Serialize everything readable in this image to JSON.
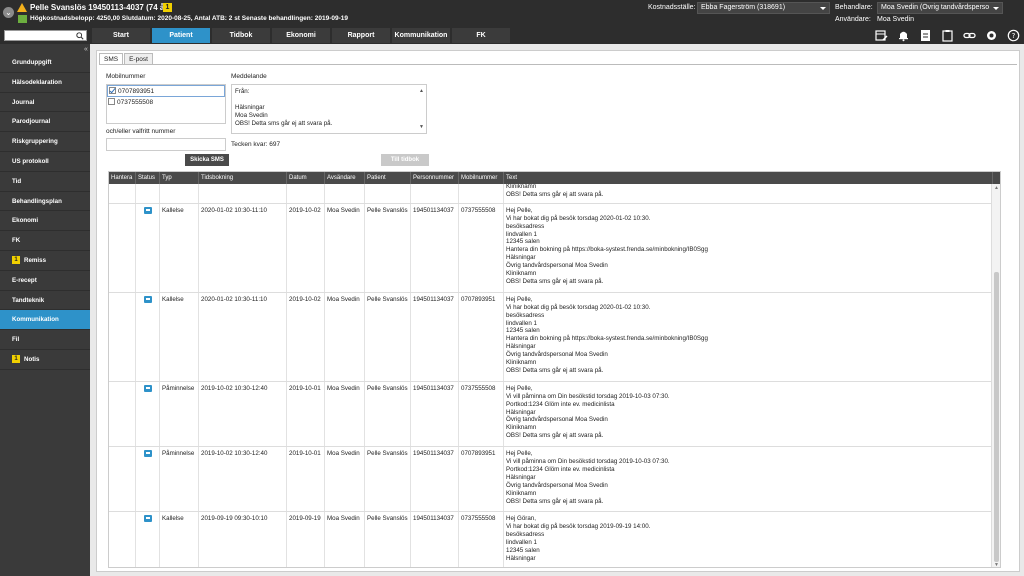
{
  "header": {
    "patient_name": "Pelle Svanslös 19450113-4037 (74 år)",
    "patient_badge": "1",
    "patient_info": "Högkostnadsbelopp: 4250,00 Slutdatum: 2020-08-25, Antal ATB: 2 st Senaste behandlingen: 2019-09-19",
    "kostnadsstalle_label": "Kostnadsställe:",
    "kostnadsstalle_value": "Ebba Fagerström (318691)",
    "behandlare_label": "Behandlare:",
    "behandlare_value": "Moa Svedin (Övrig tandvårdsperso",
    "anvandare_label": "Användare:",
    "anvandare_value": "Moa Svedin"
  },
  "search": {
    "placeholder": ""
  },
  "tabs": [
    "Start",
    "Patient",
    "Tidbok",
    "Ekonomi",
    "Rapport",
    "Kommunikation",
    "FK"
  ],
  "active_tab": "Patient",
  "sidebar": {
    "collapse": "«",
    "items": [
      {
        "label": "Grunduppgift",
        "badge": ""
      },
      {
        "label": "Hälsodeklaration",
        "badge": ""
      },
      {
        "label": "Journal",
        "badge": ""
      },
      {
        "label": "Parodjournal",
        "badge": ""
      },
      {
        "label": "Riskgruppering",
        "badge": ""
      },
      {
        "label": "US protokoll",
        "badge": ""
      },
      {
        "label": "Tid",
        "badge": ""
      },
      {
        "label": "Behandlingsplan",
        "badge": ""
      },
      {
        "label": "Ekonomi",
        "badge": ""
      },
      {
        "label": "FK",
        "badge": ""
      },
      {
        "label": "Remiss",
        "badge": "1"
      },
      {
        "label": "E-recept",
        "badge": ""
      },
      {
        "label": "Tandteknik",
        "badge": ""
      },
      {
        "label": "Kommunikation",
        "badge": ""
      },
      {
        "label": "Fil",
        "badge": ""
      },
      {
        "label": "Notis",
        "badge": "1"
      }
    ],
    "active": "Kommunikation"
  },
  "subtabs": [
    "SMS",
    "E-post"
  ],
  "sms": {
    "mobil_label": "Mobilnummer",
    "numbers": [
      {
        "number": "0707893951",
        "checked": true
      },
      {
        "number": "0737555508",
        "checked": false
      }
    ],
    "valfritt_label": "och/eller valfritt nummer",
    "send_label": "Skicka SMS",
    "meddelande_label": "Meddelande",
    "message_lines": [
      "Från:",
      "",
      "Hälsningar",
      "Moa Svedin",
      "OBS! Detta sms går ej att svara på."
    ],
    "tecken_kvar": "Tecken kvar: 697",
    "tidbok_label": "Till tidbok"
  },
  "table": {
    "columns": [
      "Hantera",
      "Status",
      "Typ",
      "Tidsbokning",
      "Datum",
      "Avsändare",
      "Patient",
      "Personnummer",
      "Mobilnummer",
      "Text"
    ],
    "rows": [
      {
        "typ": "",
        "tidsbokning": "",
        "datum": "",
        "avsandare": "",
        "patient": "",
        "personnummer": "",
        "mobil": "",
        "status": false,
        "text": [
          "Kliniknamn",
          "OBS! Detta sms går ej att svara på."
        ]
      },
      {
        "typ": "Kallelse",
        "tidsbokning": "2020-01-02 10:30-11:10",
        "datum": "2019-10-02",
        "avsandare": "Moa Svedin",
        "patient": "Pelle Svanslös",
        "personnummer": "194501134037",
        "mobil": "0737555508",
        "status": true,
        "text": [
          "Hej Pelle,",
          "Vi har bokat dig på besök torsdag 2020-01-02 10:30.",
          "besöksadress",
          "lindvallen 1",
          "12345 salen",
          "Hantera din bokning på https://boka-systest.frenda.se/minbokning/IB0Sgg",
          "Hälsningar",
          "Övrig tandvårdspersonal Moa Svedin",
          "Kliniknamn",
          "OBS! Detta sms går ej att svara på."
        ]
      },
      {
        "typ": "Kallelse",
        "tidsbokning": "2020-01-02 10:30-11:10",
        "datum": "2019-10-02",
        "avsandare": "Moa Svedin",
        "patient": "Pelle Svanslös",
        "personnummer": "194501134037",
        "mobil": "0707893951",
        "status": true,
        "text": [
          "Hej Pelle,",
          "Vi har bokat dig på besök torsdag 2020-01-02 10:30.",
          "besöksadress",
          "lindvallen 1",
          "12345 salen",
          "Hantera din bokning på https://boka-systest.frenda.se/minbokning/IB0Sgg",
          "Hälsningar",
          "Övrig tandvårdspersonal Moa Svedin",
          "Kliniknamn",
          "OBS! Detta sms går ej att svara på."
        ]
      },
      {
        "typ": "Påminnelse",
        "tidsbokning": "2019-10-02 10:30-12:40",
        "datum": "2019-10-01",
        "avsandare": "Moa Svedin",
        "patient": "Pelle Svanslös",
        "personnummer": "194501134037",
        "mobil": "0737555508",
        "status": true,
        "text": [
          "Hej Pelle,",
          "Vi vill påminna om Din besökstid torsdag 2019-10-03 07:30.",
          "Portkod:1234 Glöm inte ev. medicinlista",
          "Hälsningar",
          "Övrig tandvårdspersonal Moa Svedin",
          "Kliniknamn",
          "OBS! Detta sms går ej att svara på."
        ]
      },
      {
        "typ": "Påminnelse",
        "tidsbokning": "2019-10-02 10:30-12:40",
        "datum": "2019-10-01",
        "avsandare": "Moa Svedin",
        "patient": "Pelle Svanslös",
        "personnummer": "194501134037",
        "mobil": "0707893951",
        "status": true,
        "text": [
          "Hej Pelle,",
          "Vi vill påminna om Din besökstid torsdag 2019-10-03 07:30.",
          "Portkod:1234 Glöm inte ev. medicinlista",
          "Hälsningar",
          "Övrig tandvårdspersonal Moa Svedin",
          "Kliniknamn",
          "OBS! Detta sms går ej att svara på."
        ]
      },
      {
        "typ": "Kallelse",
        "tidsbokning": "2019-09-19 09:30-10:10",
        "datum": "2019-09-19",
        "avsandare": "Moa Svedin",
        "patient": "Pelle Svanslös",
        "personnummer": "194501134037",
        "mobil": "0737555508",
        "status": true,
        "text": [
          "Hej Göran,",
          "Vi har bokat dig på besök torsdag 2019-09-19 14:00.",
          "besöksadress",
          "lindvallen 1",
          "12345 salen",
          "Hälsningar"
        ]
      }
    ]
  },
  "colors": {
    "accent": "#2e92c9",
    "topbar": "#2d2d2d",
    "sidebar": "#3a3a3a",
    "warning": "#f2b01c",
    "badge": "#f1d000"
  },
  "icons": [
    "menu-icon",
    "warning-icon",
    "info-icon",
    "search-icon",
    "calendar-edit-icon",
    "bell-icon",
    "note-icon",
    "clipboard-icon",
    "link-icon",
    "gear-icon",
    "help-icon"
  ]
}
